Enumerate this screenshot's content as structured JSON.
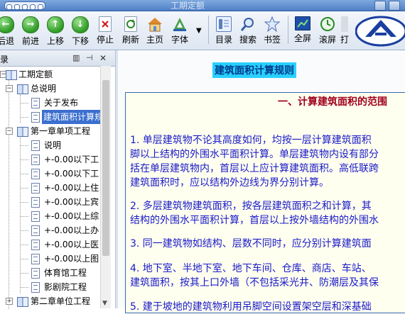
{
  "window": {
    "title": "工期定额"
  },
  "toolbar": {
    "buttons": [
      {
        "label": "后退",
        "icon": "back-arrow-icon"
      },
      {
        "label": "前进",
        "icon": "forward-arrow-icon"
      },
      {
        "label": "上移",
        "icon": "up-arrow-icon"
      },
      {
        "label": "下移",
        "icon": "down-arrow-icon"
      },
      {
        "label": "停止",
        "icon": "stop-icon"
      },
      {
        "label": "刷新",
        "icon": "refresh-icon"
      },
      {
        "label": "主页",
        "icon": "home-icon"
      },
      {
        "label": "字体",
        "icon": "font-icon"
      },
      {
        "label": "目录",
        "icon": "contents-icon"
      },
      {
        "label": "搜索",
        "icon": "search-icon"
      },
      {
        "label": "书签",
        "icon": "bookmark-icon"
      },
      {
        "label": "全屏",
        "icon": "fullscreen-icon"
      },
      {
        "label": "滚屏",
        "icon": "autoscroll-icon"
      },
      {
        "label": "打",
        "icon": "print-icon"
      }
    ]
  },
  "sidebar": {
    "header": "录",
    "tree": [
      {
        "label": "工期定额",
        "icon": "book-icon"
      },
      {
        "label": "总说明",
        "icon": "book-icon"
      },
      {
        "label": "关于发布",
        "icon": "page-icon"
      },
      {
        "label": "建筑面积计算规",
        "icon": "page-icon",
        "selected": true
      },
      {
        "label": "第一章单项工程",
        "icon": "book-icon"
      },
      {
        "label": "说明",
        "icon": "page-icon"
      },
      {
        "label": "+-0.00以下工",
        "icon": "page-icon"
      },
      {
        "label": "+-0.00以下工",
        "icon": "page-icon"
      },
      {
        "label": "+-0.00以上住",
        "icon": "page-icon"
      },
      {
        "label": "+-0.00以上宾",
        "icon": "page-icon"
      },
      {
        "label": "+-0.00以上综",
        "icon": "page-icon"
      },
      {
        "label": "+-0.00以上办",
        "icon": "page-icon"
      },
      {
        "label": "+-0.00以上医",
        "icon": "page-icon"
      },
      {
        "label": "+-0.00以上图",
        "icon": "page-icon"
      },
      {
        "label": "体育馆工程",
        "icon": "page-icon"
      },
      {
        "label": "影剧院工程",
        "icon": "page-icon"
      },
      {
        "label": "第二章单位工程",
        "icon": "book-icon"
      }
    ]
  },
  "content": {
    "title": "建筑面积计算规则",
    "section_heading": "一、计算建筑面积的范围",
    "paragraphs": [
      "1. 单层建筑物不论其高度如何，均按一层计算建筑面积",
      "脚以上结构的外围水平面积计算。单层建筑物内设有部分",
      "括在单层建筑物内，首层以上应计算建筑面积。高低联跨",
      "建筑面积时，应以结构外边线为界分别计算。",
      "2. 多层建筑物建筑面积，按各层建筑面积之和计算，其",
      "结构的外围水平面积计算，首层以上按外墙结构的外围水",
      "3. 同一建筑物如结构、层数不同时，应分别计算建筑面",
      "4. 地下室、半地下室、地下车间、仓库、商店、车站、",
      "建筑面积，按其上口外墙（不包括采光井、防潮层及其保",
      "5. 建于坡地的建筑物利用吊脚空间设置架空层和深基础"
    ]
  }
}
